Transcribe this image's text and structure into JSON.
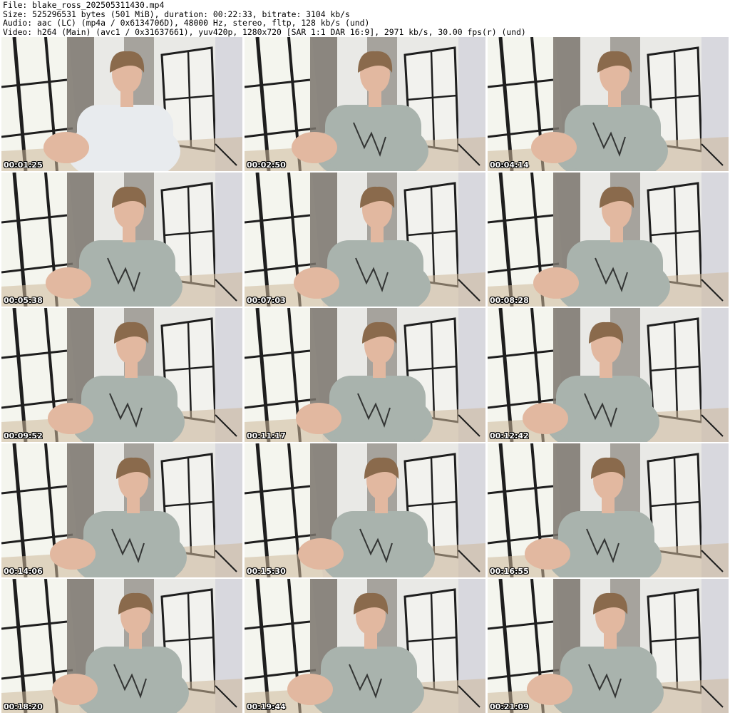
{
  "header": {
    "lines": [
      "File: blake_ross_202505311430.mp4",
      "Size: 525296531 bytes (501 MiB), duration: 00:22:33, bitrate: 3104 kb/s",
      "Audio: aac (LC) (mp4a / 0x6134706D), 48000 Hz, stereo, fltp, 128 kb/s (und)",
      "Video: h264 (Main) (avc1 / 0x31637661), yuv420p, 1280x720 [SAR 1:1 DAR 16:9], 2971 kb/s, 30.00 fps(r) (und)"
    ]
  },
  "thumbnails": [
    {
      "timestamp": "00:01:25",
      "outfit": "white-tank"
    },
    {
      "timestamp": "00:02:50",
      "outfit": "gray-sweater"
    },
    {
      "timestamp": "00:04:14",
      "outfit": "gray-sweater"
    },
    {
      "timestamp": "00:05:38",
      "outfit": "gray-sweater"
    },
    {
      "timestamp": "00:07:03",
      "outfit": "gray-sweater"
    },
    {
      "timestamp": "00:08:28",
      "outfit": "gray-sweater"
    },
    {
      "timestamp": "00:09:52",
      "outfit": "gray-sweater"
    },
    {
      "timestamp": "00:11:17",
      "outfit": "gray-sweater"
    },
    {
      "timestamp": "00:12:42",
      "outfit": "gray-sweater"
    },
    {
      "timestamp": "00:14:06",
      "outfit": "gray-sweater"
    },
    {
      "timestamp": "00:15:30",
      "outfit": "gray-sweater"
    },
    {
      "timestamp": "00:16:55",
      "outfit": "gray-sweater"
    },
    {
      "timestamp": "00:18:20",
      "outfit": "gray-sweater"
    },
    {
      "timestamp": "00:19:44",
      "outfit": "gray-sweater"
    },
    {
      "timestamp": "00:21:09",
      "outfit": "gray-sweater"
    }
  ],
  "colors": {
    "wall": "#e9e9e6",
    "window_glow": "#f4f5ee",
    "frame": "#1e1e1e",
    "curtain": "#7a746c",
    "floor": "#cdb89a",
    "sweater": "#a9b3ad",
    "tank": "#e8ebee",
    "skin": "#e2b8a0",
    "hair": "#8a6a4c",
    "timestamp_text": "#ffffff"
  }
}
